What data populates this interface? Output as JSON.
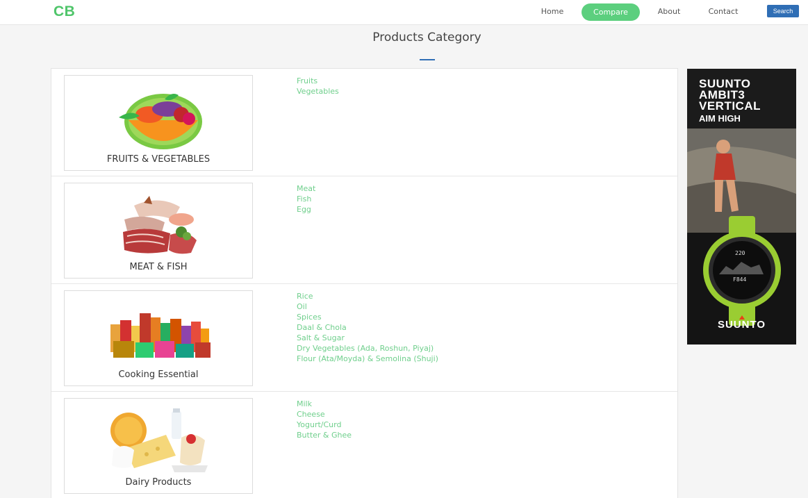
{
  "nav": {
    "logo": "CB",
    "items": [
      "Home",
      "Compare",
      "About",
      "Contact"
    ],
    "search_label": "Search",
    "accent": "#5ccf7e",
    "search_color": "#2f6eb5"
  },
  "heading": "Products Category",
  "categories": [
    {
      "title": "FRUITS & VEGETABLES",
      "icon": "fruits-basket-icon",
      "items": [
        "Fruits",
        "Vegetables"
      ]
    },
    {
      "title": "MEAT & FISH",
      "icon": "meat-fish-icon",
      "items": [
        "Meat",
        "Fish",
        "Egg"
      ]
    },
    {
      "title": "Cooking Essential",
      "icon": "grocery-products-icon",
      "items": [
        "Rice",
        "Oil",
        "Spices",
        "Daal & Chola",
        "Salt & Sugar",
        "Dry Vegetables (Ada, Roshun, Piyaj)",
        "Flour (Ata/Moyda) & Semolina (Shuji)"
      ]
    },
    {
      "title": "Dairy Products",
      "icon": "dairy-products-icon",
      "items": [
        "Milk",
        "Cheese",
        "Yogurt/Curd",
        "Butter & Ghee"
      ]
    }
  ],
  "ad": {
    "lines": [
      "SUUNTO",
      "AMBIT3",
      "VERTICAL"
    ],
    "tagline": "AIM HIGH",
    "brand": "SUUNTO",
    "watch_readout": "220",
    "watch_readout_2": "F844"
  },
  "colors": {
    "link": "#6fcf8c",
    "brand_green": "#4fc56a"
  }
}
